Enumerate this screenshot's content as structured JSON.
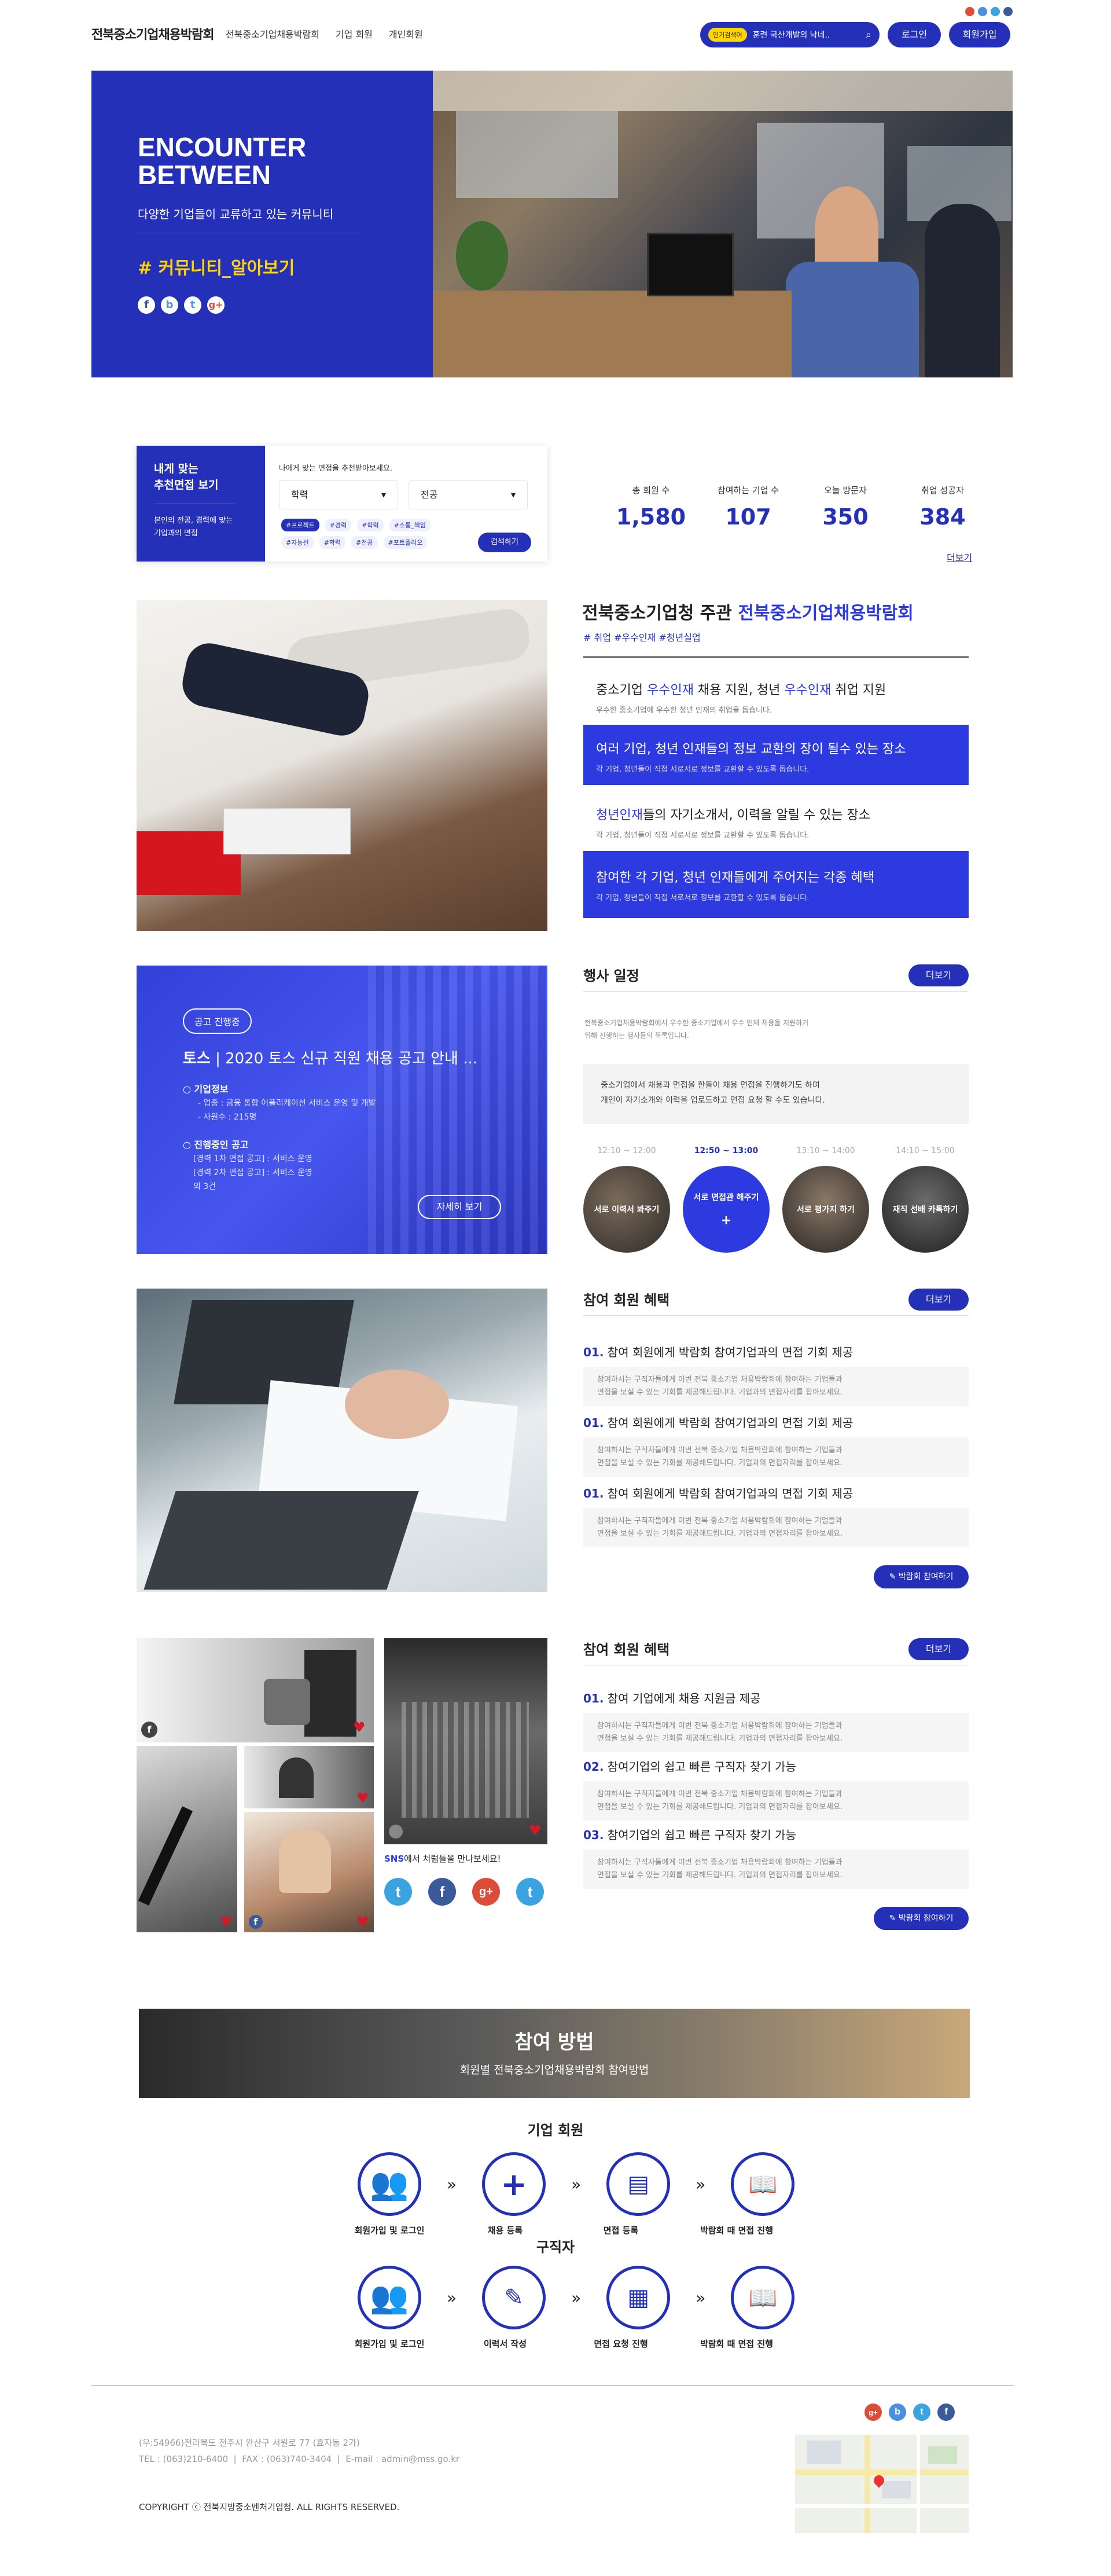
{
  "header": {
    "logo": "전북중소기업채용박람회",
    "nav": [
      "전북중소기업채용박람회",
      "기업 회원",
      "개인회원"
    ],
    "search_tag": "인기검색어",
    "search_placeholder": "훈련 국산개발의 낙네..",
    "login": "로그인",
    "signup": "회원가입"
  },
  "hero": {
    "title_line1": "ENCOUNTER",
    "title_line2": "BETWEEN",
    "subtitle": "다양한 기업들이 교류하고 있는 커뮤니티",
    "hashtag": "# 커뮤니티_알아보기"
  },
  "interview_search": {
    "title_line1": "내게 맞는",
    "title_line2": "추천면접 보기",
    "desc_line1": "본인의 전공, 경력에 맞는",
    "desc_line2": "기업과의 면접",
    "hint": "나에게 맞는 면접을 추천받아보세요.",
    "select1": "학력",
    "select2": "전공",
    "chips": [
      "#프로젝트",
      "#경력",
      "#학력",
      "#소통_책임",
      "#자능선",
      "#학력",
      "#전공",
      "#포트폴리오"
    ],
    "button": "검색하기"
  },
  "stats": {
    "items": [
      {
        "label": "총 회원 수",
        "value": "1,580"
      },
      {
        "label": "참여하는 기업 수",
        "value": "107"
      },
      {
        "label": "오늘 방문자",
        "value": "350"
      },
      {
        "label": "취업 성공자",
        "value": "384"
      }
    ],
    "more": "더보기"
  },
  "intro": {
    "title_prefix": "전북중소기업청 주관 ",
    "title_highlight": "전북중소기업채용박람회",
    "tags": "# 취업  #우수인재  #청년실업",
    "features": [
      {
        "title_a": "중소기업 ",
        "title_b": "우수인재",
        "title_c": " 채용 지원, 청년 ",
        "title_d": "우수인재",
        "title_e": " 취업 지원",
        "desc": "우수한 중소기업에 우수한 청년 인재의 취업을 돕습니다."
      },
      {
        "title": "여러 기업, 청년 인재들의 정보 교환의 장이 될수 있는 장소",
        "desc": "각 기업, 청년들이 직접 서로서로 정보를 교환할 수 있도록 돕습니다."
      },
      {
        "title_a": "청년인재",
        "title_b": "들의 자기소개서, 이력을 알릴 수 있는 장소",
        "desc": "각 기업, 청년들이 직접 서로서로 정보를 교환할 수 있도록 돕습니다."
      },
      {
        "title": "참여한 각 기업, 청년 인재들에게 주어지는 각종 혜택",
        "desc": "각 기업, 청년들이 직접 서로서로 정보를 교환할 수 있도록 돕습니다."
      }
    ]
  },
  "notice": {
    "badge": "공고 진행중",
    "company": "토스",
    "title": "2020 토스 신규 직원 채용 공고 안내 ...",
    "section1": "기업정보",
    "section1_lines": [
      "- 업종 : 금융 통합 어플리케이션 서비스 운영 및 개발",
      "- 사원수 : 215명"
    ],
    "section2": "진행중인 공고",
    "section2_lines": [
      "[경력 1차 면접 공고] : 서비스 운영",
      "[경력 2차 면접 공고] : 서비스 운영",
      "외 3건"
    ],
    "button": "자세히 보기"
  },
  "events": {
    "title": "행사 일정",
    "more": "더보기",
    "desc_line1": "전북중소기업채용박람회에서 우수한 중소기업에서 우수 인재 채용을 지원하기",
    "desc_line2": "위해 진행하는 행사들의 목록입니다.",
    "box_line1": "중소기업에서 채용과 면접을 한둘이 채용 면접을 진행하기도 하며",
    "box_line2": "개인이 자기소개와 이력을 업로드하고 면접 요청 할 수도 있습니다.",
    "items": [
      {
        "time": "12:10 ~ 12:00",
        "label": "서로 이력서 봐주기"
      },
      {
        "time": "12:50 ~ 13:00",
        "label": "서로 면접관 해주기"
      },
      {
        "time": "13:10 ~ 14:00",
        "label": "서로 평가지 하기"
      },
      {
        "time": "14:10 ~ 15:00",
        "label": "재직 선배 카톡하기"
      }
    ]
  },
  "benefits1": {
    "title": "참여 회원 혜택",
    "more": "더보기",
    "items": [
      {
        "num": "01.",
        "title": "참여 회원에게 박람회 참여기업과의 면접 기회 제공",
        "desc_line1": "참여하시는 구직자들에게 이번 전북 중소기업 채용박람회에 참여하는 기업들과",
        "desc_line2": "면접을 보실 수 있는 기회를 제공해드립니다. 기업과의 면접자리를 잡아보세요."
      },
      {
        "num": "01.",
        "title": "참여 회원에게 박람회 참여기업과의 면접 기회 제공",
        "desc_line1": "참여하시는 구직자들에게 이번 전북 중소기업 채용박람회에 참여하는 기업들과",
        "desc_line2": "면접을 보실 수 있는 기회를 제공해드립니다. 기업과의 면접자리를 잡아보세요."
      },
      {
        "num": "01.",
        "title": "참여 회원에게 박람회 참여기업과의 면접 기회 제공",
        "desc_line1": "참여하시는 구직자들에게 이번 전북 중소기업 채용박람회에 참여하는 기업들과",
        "desc_line2": "면접을 보실 수 있는 기회를 제공해드립니다. 기업과의 면접자리를 잡아보세요."
      }
    ],
    "button": "박람회 참여하기"
  },
  "benefits2": {
    "title": "참여 회원 혜택",
    "more": "더보기",
    "items": [
      {
        "num": "01.",
        "title": "참여 기업에게 채용 지원금 제공",
        "desc_line1": "참여하시는 구직자들에게 이번 전북 중소기업 채용박람회에 참여하는 기업들과",
        "desc_line2": "면접을 보실 수 있는 기회를 제공해드립니다. 기업과의 면접자리를 잡아보세요."
      },
      {
        "num": "02.",
        "title": "참여기업의 쉽고 빠른 구직자 찾기 가능",
        "desc_line1": "참여하시는 구직자들에게 이번 전북 중소기업 채용박람회에 참여하는 기업들과",
        "desc_line2": "면접을 보실 수 있는 기회를 제공해드립니다. 기업과의 면접자리를 잡아보세요."
      },
      {
        "num": "03.",
        "title": "참여기업의 쉽고 빠른 구직자 찾기 가능",
        "desc_line1": "참여하시는 구직자들에게 이번 전북 중소기업 채용박람회에 참여하는 기업들과",
        "desc_line2": "면접을 보실 수 있는 기회를 제공해드립니다. 기업과의 면접자리를 잡아보세요."
      }
    ],
    "button": "박람회 참여하기"
  },
  "sns": {
    "caption_highlight": "SNS",
    "caption_rest": "에서 처럼들을 만나보세요!"
  },
  "howto": {
    "title": "참여 방법",
    "subtitle": "회원별 전북중소기업채용박람회 참여방법",
    "company_title": "기업 회원",
    "company_steps": [
      "회원가입 및 로그인",
      "채용 등록",
      "면접 등록",
      "박람회 때 면접 진행"
    ],
    "seeker_title": "구직자",
    "seeker_steps": [
      "회원가입 및 로그인",
      "이력서 작성",
      "면접 요청 진행",
      "박람회 때 면접 진행"
    ]
  },
  "footer": {
    "address": "(우:54966)전라북도 전주시 완산구 서원로 77 (효자동 2가)",
    "tel": "TEL : (063)210-6400",
    "fax": "FAX : (063)740-3404",
    "email": "E-mail : admin@mss.go.kr",
    "copyright": "COPYRIGHT ⓒ 전북지방중소벤처기업청. ALL RIGHTS RESERVED."
  },
  "colors": {
    "primary": "#2430b8",
    "accent": "#2c3ae0",
    "hashtag": "#ffd400"
  }
}
